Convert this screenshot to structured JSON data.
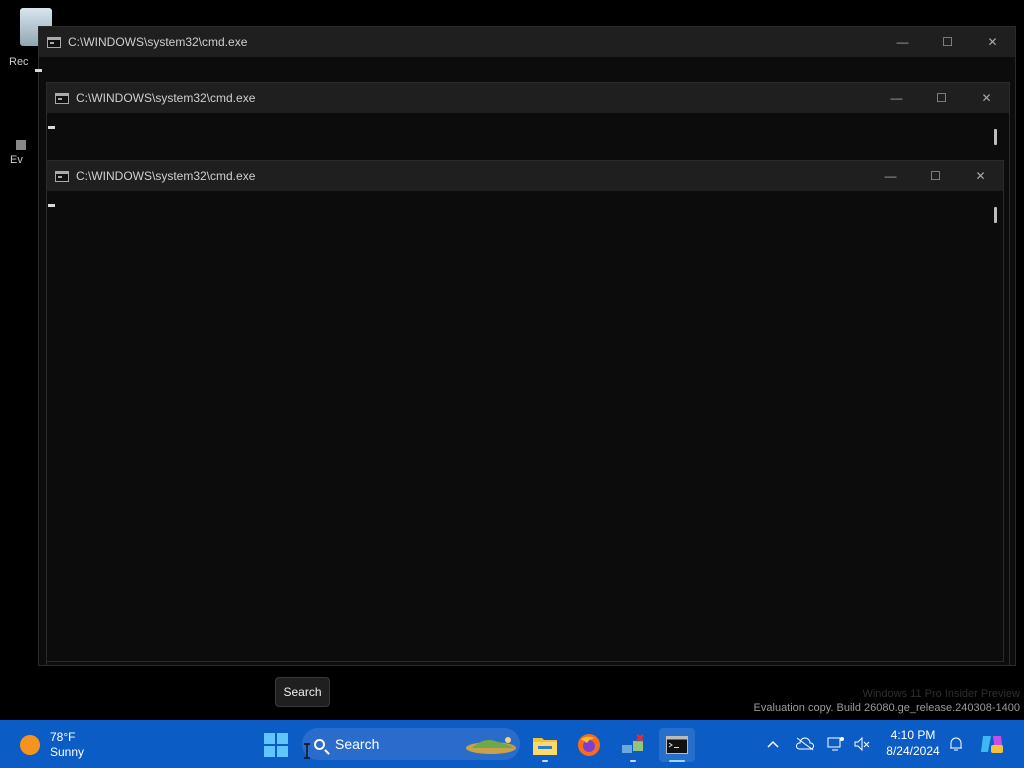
{
  "desktop": {
    "icons": [
      {
        "label": "Rec"
      },
      {
        "label": "Ev"
      }
    ]
  },
  "windows": [
    {
      "title": "C:\\WINDOWS\\system32\\cmd.exe"
    },
    {
      "title": "C:\\WINDOWS\\system32\\cmd.exe"
    },
    {
      "title": "C:\\WINDOWS\\system32\\cmd.exe"
    }
  ],
  "window_controls": {
    "minimize": "—",
    "maximize": "☐",
    "close": "✕"
  },
  "tooltip": {
    "text": "Search"
  },
  "watermark": {
    "line1": "Windows 11 Pro Insider Preview",
    "line2": "Evaluation copy. Build 26080.ge_release.240308-1400"
  },
  "taskbar": {
    "weather": {
      "temp": "78°F",
      "condition": "Sunny"
    },
    "search": {
      "placeholder": "Search"
    },
    "apps": [
      {
        "name": "file-explorer",
        "active": false
      },
      {
        "name": "firefox",
        "active": false
      },
      {
        "name": "network-app",
        "active": false
      },
      {
        "name": "command-prompt",
        "active": true
      }
    ],
    "clock": {
      "time": "4:10 PM",
      "date": "8/24/2024"
    }
  },
  "colors": {
    "taskbar": "#0b5cc4",
    "console_bg": "#0c0c0c",
    "titlebar": "#1f1f1f"
  }
}
